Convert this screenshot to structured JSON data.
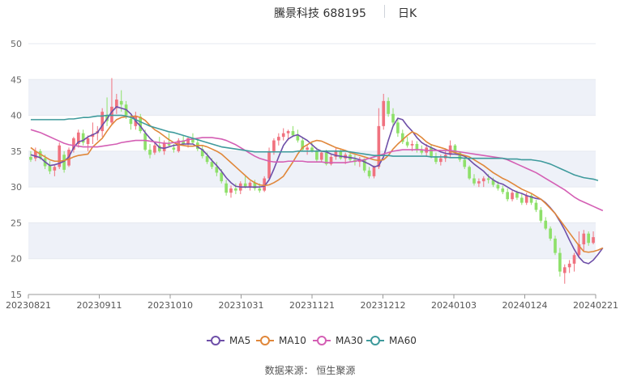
{
  "title": {
    "name": "騰景科技 688195",
    "period": "日K"
  },
  "source": "数据来源： 恒生聚源",
  "legend": [
    {
      "label": "MA5",
      "color": "#6e4fa8"
    },
    {
      "label": "MA10",
      "color": "#e0873a"
    },
    {
      "label": "MA30",
      "color": "#d45fb4"
    },
    {
      "label": "MA60",
      "color": "#3e9a9c"
    }
  ],
  "colors": {
    "up": "#f0727f",
    "down": "#8ee06a",
    "grid_band": "#eef1f8"
  },
  "chart_data": {
    "type": "candlestick",
    "ylim": [
      15,
      50
    ],
    "y_ticks": [
      15,
      20,
      25,
      30,
      35,
      40,
      45,
      50
    ],
    "x_tick_labels": [
      "20230821",
      "20230911",
      "20231010",
      "20231031",
      "20231121",
      "20231212",
      "20240103",
      "20240124",
      "20240221"
    ],
    "candles": [
      {
        "o": 34.2,
        "h": 35.0,
        "l": 33.5,
        "c": 33.8
      },
      {
        "o": 34.0,
        "h": 35.5,
        "l": 33.6,
        "c": 35.0
      },
      {
        "o": 35.0,
        "h": 35.3,
        "l": 33.8,
        "c": 34.0
      },
      {
        "o": 34.0,
        "h": 34.5,
        "l": 32.5,
        "c": 32.9
      },
      {
        "o": 33.0,
        "h": 33.6,
        "l": 31.8,
        "c": 32.2
      },
      {
        "o": 32.3,
        "h": 33.0,
        "l": 31.5,
        "c": 32.8
      },
      {
        "o": 32.8,
        "h": 36.2,
        "l": 32.5,
        "c": 35.8
      },
      {
        "o": 34.5,
        "h": 35.0,
        "l": 32.0,
        "c": 32.4
      },
      {
        "o": 33.0,
        "h": 35.5,
        "l": 32.8,
        "c": 35.2
      },
      {
        "o": 35.2,
        "h": 37.0,
        "l": 34.8,
        "c": 36.8
      },
      {
        "o": 36.0,
        "h": 38.0,
        "l": 35.5,
        "c": 37.6
      },
      {
        "o": 37.5,
        "h": 38.0,
        "l": 35.8,
        "c": 36.2
      },
      {
        "o": 36.0,
        "h": 37.2,
        "l": 35.0,
        "c": 36.8
      },
      {
        "o": 37.0,
        "h": 39.0,
        "l": 36.0,
        "c": 37.4
      },
      {
        "o": 37.5,
        "h": 38.5,
        "l": 36.5,
        "c": 37.8
      },
      {
        "o": 37.8,
        "h": 41.0,
        "l": 37.0,
        "c": 40.5
      },
      {
        "o": 40.0,
        "h": 42.5,
        "l": 38.5,
        "c": 39.2
      },
      {
        "o": 39.0,
        "h": 45.2,
        "l": 38.6,
        "c": 41.2
      },
      {
        "o": 41.0,
        "h": 43.0,
        "l": 40.2,
        "c": 42.2
      },
      {
        "o": 42.0,
        "h": 43.5,
        "l": 40.5,
        "c": 41.5
      },
      {
        "o": 41.5,
        "h": 42.0,
        "l": 39.5,
        "c": 40.0
      },
      {
        "o": 39.5,
        "h": 40.0,
        "l": 38.0,
        "c": 38.8
      },
      {
        "o": 38.5,
        "h": 40.5,
        "l": 38.0,
        "c": 39.8
      },
      {
        "o": 39.8,
        "h": 40.2,
        "l": 37.5,
        "c": 37.8
      },
      {
        "o": 37.5,
        "h": 38.0,
        "l": 35.0,
        "c": 35.2
      },
      {
        "o": 35.2,
        "h": 36.0,
        "l": 34.0,
        "c": 34.5
      },
      {
        "o": 34.8,
        "h": 36.2,
        "l": 34.5,
        "c": 35.8
      },
      {
        "o": 35.8,
        "h": 37.0,
        "l": 34.8,
        "c": 35.0
      },
      {
        "o": 35.0,
        "h": 36.5,
        "l": 34.5,
        "c": 36.2
      },
      {
        "o": 36.0,
        "h": 37.5,
        "l": 35.5,
        "c": 35.8
      },
      {
        "o": 35.5,
        "h": 36.0,
        "l": 34.8,
        "c": 35.2
      },
      {
        "o": 35.0,
        "h": 36.8,
        "l": 34.8,
        "c": 36.5
      },
      {
        "o": 36.5,
        "h": 37.2,
        "l": 35.8,
        "c": 36.0
      },
      {
        "o": 36.0,
        "h": 37.0,
        "l": 35.5,
        "c": 36.8
      },
      {
        "o": 36.8,
        "h": 37.5,
        "l": 36.0,
        "c": 36.2
      },
      {
        "o": 36.2,
        "h": 36.8,
        "l": 35.0,
        "c": 35.3
      },
      {
        "o": 35.3,
        "h": 35.8,
        "l": 34.0,
        "c": 34.3
      },
      {
        "o": 34.3,
        "h": 34.8,
        "l": 33.2,
        "c": 33.5
      },
      {
        "o": 33.5,
        "h": 34.0,
        "l": 32.5,
        "c": 32.8
      },
      {
        "o": 32.8,
        "h": 33.5,
        "l": 31.5,
        "c": 32.0
      },
      {
        "o": 32.0,
        "h": 32.5,
        "l": 30.5,
        "c": 30.8
      },
      {
        "o": 30.5,
        "h": 31.0,
        "l": 28.8,
        "c": 29.2
      },
      {
        "o": 29.2,
        "h": 30.2,
        "l": 28.5,
        "c": 29.8
      },
      {
        "o": 29.8,
        "h": 30.5,
        "l": 29.0,
        "c": 29.5
      },
      {
        "o": 29.5,
        "h": 30.8,
        "l": 29.0,
        "c": 30.5
      },
      {
        "o": 30.5,
        "h": 31.5,
        "l": 29.8,
        "c": 30.0
      },
      {
        "o": 30.0,
        "h": 30.8,
        "l": 29.5,
        "c": 30.6
      },
      {
        "o": 30.6,
        "h": 31.0,
        "l": 29.5,
        "c": 29.8
      },
      {
        "o": 29.8,
        "h": 30.5,
        "l": 29.2,
        "c": 29.5
      },
      {
        "o": 29.5,
        "h": 31.5,
        "l": 29.3,
        "c": 31.2
      },
      {
        "o": 31.2,
        "h": 35.5,
        "l": 31.0,
        "c": 35.0
      },
      {
        "o": 35.0,
        "h": 36.8,
        "l": 34.5,
        "c": 36.5
      },
      {
        "o": 36.5,
        "h": 37.5,
        "l": 35.8,
        "c": 37.0
      },
      {
        "o": 37.0,
        "h": 38.2,
        "l": 36.5,
        "c": 37.5
      },
      {
        "o": 37.5,
        "h": 38.0,
        "l": 36.5,
        "c": 37.8
      },
      {
        "o": 37.8,
        "h": 38.5,
        "l": 37.0,
        "c": 37.2
      },
      {
        "o": 37.2,
        "h": 38.0,
        "l": 36.2,
        "c": 36.5
      },
      {
        "o": 36.5,
        "h": 37.0,
        "l": 35.0,
        "c": 35.2
      },
      {
        "o": 35.2,
        "h": 36.0,
        "l": 34.5,
        "c": 35.5
      },
      {
        "o": 35.5,
        "h": 36.2,
        "l": 34.8,
        "c": 35.0
      },
      {
        "o": 35.0,
        "h": 35.5,
        "l": 33.5,
        "c": 33.8
      },
      {
        "o": 33.8,
        "h": 35.0,
        "l": 33.5,
        "c": 34.8
      },
      {
        "o": 34.8,
        "h": 35.2,
        "l": 33.0,
        "c": 33.2
      },
      {
        "o": 33.2,
        "h": 34.5,
        "l": 33.0,
        "c": 34.2
      },
      {
        "o": 34.2,
        "h": 35.5,
        "l": 33.8,
        "c": 35.0
      },
      {
        "o": 35.0,
        "h": 35.2,
        "l": 33.8,
        "c": 34.0
      },
      {
        "o": 34.0,
        "h": 34.8,
        "l": 33.2,
        "c": 34.5
      },
      {
        "o": 34.5,
        "h": 35.0,
        "l": 33.5,
        "c": 33.8
      },
      {
        "o": 33.8,
        "h": 34.5,
        "l": 33.0,
        "c": 33.5
      },
      {
        "o": 33.5,
        "h": 34.2,
        "l": 32.8,
        "c": 33.9
      },
      {
        "o": 33.9,
        "h": 34.0,
        "l": 32.0,
        "c": 32.3
      },
      {
        "o": 32.3,
        "h": 32.8,
        "l": 31.2,
        "c": 31.5
      },
      {
        "o": 31.5,
        "h": 33.0,
        "l": 31.2,
        "c": 32.8
      },
      {
        "o": 32.8,
        "h": 41.0,
        "l": 32.5,
        "c": 38.5
      },
      {
        "o": 38.5,
        "h": 43.0,
        "l": 38.0,
        "c": 42.0
      },
      {
        "o": 42.0,
        "h": 42.5,
        "l": 39.8,
        "c": 40.2
      },
      {
        "o": 40.2,
        "h": 41.0,
        "l": 38.5,
        "c": 39.0
      },
      {
        "o": 39.0,
        "h": 39.5,
        "l": 37.0,
        "c": 37.5
      },
      {
        "o": 37.5,
        "h": 38.0,
        "l": 36.0,
        "c": 36.3
      },
      {
        "o": 36.3,
        "h": 37.0,
        "l": 35.5,
        "c": 35.8
      },
      {
        "o": 35.8,
        "h": 36.5,
        "l": 35.0,
        "c": 36.0
      },
      {
        "o": 36.0,
        "h": 36.4,
        "l": 34.8,
        "c": 35.2
      },
      {
        "o": 35.2,
        "h": 35.8,
        "l": 34.5,
        "c": 34.8
      },
      {
        "o": 34.8,
        "h": 36.0,
        "l": 34.2,
        "c": 35.5
      },
      {
        "o": 35.5,
        "h": 36.0,
        "l": 34.0,
        "c": 34.3
      },
      {
        "o": 34.3,
        "h": 34.8,
        "l": 33.2,
        "c": 33.5
      },
      {
        "o": 33.5,
        "h": 34.5,
        "l": 33.0,
        "c": 34.0
      },
      {
        "o": 34.0,
        "h": 35.0,
        "l": 33.5,
        "c": 34.5
      },
      {
        "o": 34.5,
        "h": 36.5,
        "l": 34.2,
        "c": 35.8
      },
      {
        "o": 35.8,
        "h": 36.0,
        "l": 34.5,
        "c": 34.8
      },
      {
        "o": 34.8,
        "h": 35.0,
        "l": 33.5,
        "c": 33.8
      },
      {
        "o": 33.8,
        "h": 34.2,
        "l": 32.5,
        "c": 32.8
      },
      {
        "o": 32.8,
        "h": 33.0,
        "l": 31.0,
        "c": 31.2
      },
      {
        "o": 31.2,
        "h": 31.8,
        "l": 30.2,
        "c": 30.5
      },
      {
        "o": 30.5,
        "h": 31.2,
        "l": 30.0,
        "c": 30.8
      },
      {
        "o": 30.8,
        "h": 31.5,
        "l": 30.0,
        "c": 31.2
      },
      {
        "o": 31.2,
        "h": 31.8,
        "l": 30.5,
        "c": 31.0
      },
      {
        "o": 31.0,
        "h": 31.3,
        "l": 30.0,
        "c": 30.3
      },
      {
        "o": 30.3,
        "h": 30.8,
        "l": 29.5,
        "c": 29.8
      },
      {
        "o": 29.8,
        "h": 30.2,
        "l": 29.0,
        "c": 29.3
      },
      {
        "o": 29.3,
        "h": 29.8,
        "l": 28.0,
        "c": 28.3
      },
      {
        "o": 28.3,
        "h": 29.5,
        "l": 28.0,
        "c": 29.2
      },
      {
        "o": 29.2,
        "h": 29.5,
        "l": 28.2,
        "c": 28.5
      },
      {
        "o": 28.5,
        "h": 29.0,
        "l": 27.5,
        "c": 27.8
      },
      {
        "o": 27.8,
        "h": 29.2,
        "l": 27.5,
        "c": 28.8
      },
      {
        "o": 28.8,
        "h": 29.0,
        "l": 27.5,
        "c": 27.8
      },
      {
        "o": 27.8,
        "h": 28.2,
        "l": 26.5,
        "c": 26.8
      },
      {
        "o": 26.8,
        "h": 27.2,
        "l": 25.0,
        "c": 25.3
      },
      {
        "o": 25.3,
        "h": 25.8,
        "l": 24.0,
        "c": 24.2
      },
      {
        "o": 24.2,
        "h": 24.5,
        "l": 22.5,
        "c": 22.8
      },
      {
        "o": 22.8,
        "h": 23.2,
        "l": 20.5,
        "c": 20.8
      },
      {
        "o": 20.8,
        "h": 21.5,
        "l": 17.5,
        "c": 18.2
      },
      {
        "o": 18.0,
        "h": 19.2,
        "l": 16.5,
        "c": 18.8
      },
      {
        "o": 18.8,
        "h": 19.8,
        "l": 18.0,
        "c": 19.3
      },
      {
        "o": 19.3,
        "h": 20.8,
        "l": 18.2,
        "c": 20.5
      },
      {
        "o": 20.5,
        "h": 23.8,
        "l": 20.2,
        "c": 22.0
      },
      {
        "o": 22.0,
        "h": 24.0,
        "l": 21.0,
        "c": 23.5
      },
      {
        "o": 23.5,
        "h": 23.8,
        "l": 21.8,
        "c": 22.2
      },
      {
        "o": 22.2,
        "h": 23.8,
        "l": 22.0,
        "c": 23.0
      }
    ],
    "series": [
      {
        "name": "MA5",
        "color": "#6e4fa8",
        "values": [
          34.5,
          34.3,
          34.1,
          33.5,
          33.0,
          33.1,
          33.3,
          33.6,
          34.2,
          35.5,
          36.3,
          36.5,
          37.0,
          37.3,
          37.6,
          38.6,
          39.5,
          40.5,
          41.2,
          41.0,
          40.8,
          40.2,
          39.2,
          38.5,
          37.6,
          36.8,
          36.2,
          35.5,
          35.4,
          35.6,
          35.8,
          35.9,
          36.0,
          36.0,
          36.0,
          35.6,
          35.2,
          34.5,
          33.7,
          33.0,
          32.2,
          31.3,
          30.6,
          30.1,
          30.0,
          30.0,
          30.0,
          30.0,
          30.0,
          30.1,
          31.0,
          32.5,
          34.2,
          35.8,
          36.7,
          37.1,
          37.3,
          36.9,
          36.5,
          35.9,
          35.3,
          35.0,
          34.9,
          34.6,
          34.4,
          34.3,
          34.2,
          34.1,
          34.0,
          33.8,
          33.5,
          33.2,
          32.8,
          33.0,
          34.2,
          36.5,
          38.5,
          39.6,
          39.4,
          38.5,
          37.8,
          36.9,
          36.2,
          35.8,
          35.5,
          35.2,
          34.9,
          34.7,
          34.6,
          34.6,
          34.5,
          34.3,
          33.8,
          33.2,
          32.7,
          32.2,
          31.5,
          31.0,
          30.6,
          30.4,
          30.0,
          29.6,
          29.3,
          29.1,
          28.8,
          28.6,
          28.4,
          28.3,
          27.8,
          27.1,
          26.3,
          25.2,
          24.0,
          22.6,
          21.3,
          20.2,
          19.5,
          19.3,
          19.8,
          20.6,
          21.5
        ]
      },
      {
        "name": "MA10",
        "color": "#e0873a",
        "values": [
          35.5,
          35.0,
          34.6,
          34.2,
          33.8,
          33.6,
          33.6,
          33.7,
          33.9,
          34.2,
          34.4,
          34.5,
          34.6,
          35.6,
          36.2,
          36.8,
          37.8,
          38.7,
          39.4,
          39.7,
          39.8,
          39.8,
          39.9,
          39.7,
          39.3,
          38.6,
          38.0,
          37.6,
          37.1,
          36.6,
          36.2,
          35.9,
          35.8,
          35.7,
          35.7,
          35.8,
          35.8,
          35.6,
          35.3,
          35.0,
          34.6,
          34.0,
          33.4,
          32.8,
          32.2,
          31.6,
          31.0,
          30.6,
          30.3,
          30.2,
          30.3,
          30.6,
          31.0,
          31.5,
          32.5,
          33.5,
          34.6,
          35.5,
          35.9,
          36.3,
          36.5,
          36.4,
          36.1,
          35.8,
          35.5,
          35.3,
          35.1,
          34.8,
          34.6,
          34.4,
          34.2,
          34.0,
          33.8,
          33.7,
          33.8,
          34.4,
          35.3,
          36.0,
          36.6,
          37.2,
          37.7,
          37.4,
          36.9,
          36.3,
          35.9,
          35.7,
          35.5,
          35.3,
          35.0,
          34.8,
          34.6,
          34.4,
          34.2,
          33.8,
          33.4,
          33.0,
          32.5,
          32.0,
          31.6,
          31.2,
          30.9,
          30.5,
          30.1,
          29.7,
          29.4,
          29.1,
          28.7,
          28.3,
          27.7,
          27.0,
          26.3,
          25.4,
          24.5,
          23.6,
          22.7,
          21.8,
          21.0,
          20.9,
          21.0,
          21.2,
          21.5
        ]
      },
      {
        "name": "MA30",
        "color": "#d45fb4",
        "values": [
          38.0,
          37.8,
          37.6,
          37.3,
          37.0,
          36.7,
          36.4,
          36.1,
          35.9,
          35.8,
          35.7,
          35.6,
          35.6,
          35.6,
          35.6,
          35.7,
          35.8,
          35.9,
          36.0,
          36.2,
          36.3,
          36.4,
          36.5,
          36.5,
          36.5,
          36.4,
          36.3,
          36.2,
          36.1,
          36.1,
          36.2,
          36.3,
          36.4,
          36.6,
          36.7,
          36.8,
          36.9,
          36.9,
          36.9,
          36.8,
          36.7,
          36.5,
          36.2,
          35.9,
          35.5,
          35.1,
          34.7,
          34.3,
          34.0,
          33.8,
          33.6,
          33.5,
          33.5,
          33.5,
          33.6,
          33.6,
          33.6,
          33.6,
          33.5,
          33.5,
          33.5,
          33.5,
          33.4,
          33.4,
          33.4,
          33.4,
          33.4,
          33.5,
          33.6,
          33.7,
          33.8,
          34.0,
          34.2,
          34.4,
          34.6,
          34.8,
          35.0,
          35.1,
          35.2,
          35.2,
          35.2,
          35.2,
          35.2,
          35.1,
          35.1,
          35.1,
          35.1,
          35.1,
          35.1,
          35.0,
          34.9,
          34.8,
          34.7,
          34.6,
          34.5,
          34.4,
          34.3,
          34.2,
          34.1,
          34.0,
          33.8,
          33.5,
          33.2,
          32.9,
          32.6,
          32.3,
          32.0,
          31.6,
          31.2,
          30.8,
          30.4,
          30.0,
          29.6,
          29.1,
          28.6,
          28.2,
          27.9,
          27.6,
          27.3,
          27.0,
          26.7
        ]
      },
      {
        "name": "MA60",
        "color": "#3e9a9c",
        "values": [
          39.4,
          39.4,
          39.4,
          39.4,
          39.4,
          39.4,
          39.4,
          39.4,
          39.5,
          39.5,
          39.6,
          39.7,
          39.7,
          39.8,
          39.9,
          39.9,
          40.0,
          40.0,
          40.0,
          40.0,
          39.9,
          39.7,
          39.4,
          39.1,
          38.8,
          38.5,
          38.3,
          38.1,
          37.9,
          37.7,
          37.6,
          37.4,
          37.2,
          37.0,
          36.8,
          36.6,
          36.4,
          36.2,
          36.0,
          35.8,
          35.6,
          35.5,
          35.4,
          35.3,
          35.2,
          35.1,
          35.0,
          34.9,
          34.9,
          34.9,
          34.9,
          34.9,
          34.9,
          34.9,
          34.9,
          34.9,
          35.0,
          35.0,
          35.0,
          35.0,
          35.0,
          35.0,
          35.0,
          35.0,
          35.0,
          35.0,
          35.0,
          34.9,
          34.8,
          34.7,
          34.6,
          34.5,
          34.4,
          34.4,
          34.4,
          34.4,
          34.3,
          34.3,
          34.3,
          34.3,
          34.3,
          34.3,
          34.3,
          34.3,
          34.2,
          34.2,
          34.2,
          34.2,
          34.1,
          34.1,
          34.1,
          34.0,
          34.0,
          34.0,
          34.0,
          34.0,
          34.0,
          34.0,
          34.0,
          34.0,
          33.9,
          33.9,
          33.9,
          33.8,
          33.8,
          33.8,
          33.7,
          33.6,
          33.4,
          33.2,
          32.9,
          32.6,
          32.3,
          32.0,
          31.7,
          31.5,
          31.3,
          31.2,
          31.1,
          30.9
        ]
      }
    ]
  }
}
